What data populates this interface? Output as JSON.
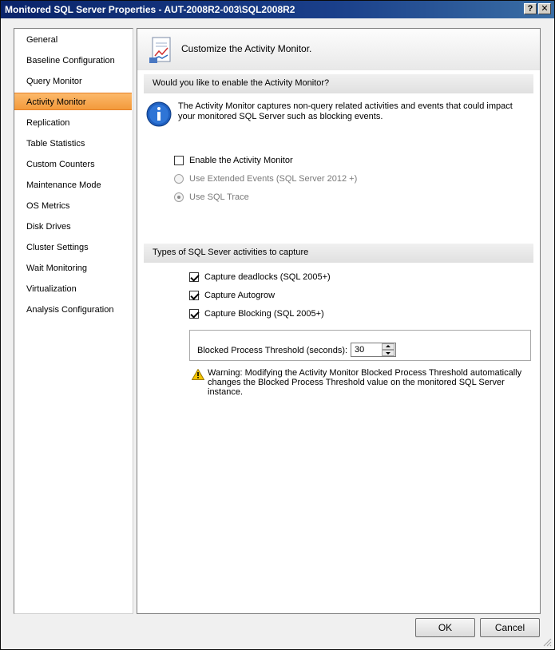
{
  "window": {
    "title": "Monitored SQL Server Properties - AUT-2008R2-003\\SQL2008R2",
    "help_label": "?",
    "close_label": "✕"
  },
  "sidebar": {
    "items": [
      {
        "label": "General",
        "selected": false
      },
      {
        "label": "Baseline Configuration",
        "selected": false
      },
      {
        "label": "Query Monitor",
        "selected": false
      },
      {
        "label": "Activity Monitor",
        "selected": true
      },
      {
        "label": "Replication",
        "selected": false
      },
      {
        "label": "Table Statistics",
        "selected": false
      },
      {
        "label": "Custom Counters",
        "selected": false
      },
      {
        "label": "Maintenance Mode",
        "selected": false
      },
      {
        "label": "OS Metrics",
        "selected": false
      },
      {
        "label": "Disk Drives",
        "selected": false
      },
      {
        "label": "Cluster Settings",
        "selected": false
      },
      {
        "label": "Wait Monitoring",
        "selected": false
      },
      {
        "label": "Virtualization",
        "selected": false
      },
      {
        "label": "Analysis Configuration",
        "selected": false
      }
    ]
  },
  "main": {
    "title": "Customize the Activity Monitor.",
    "enable_section": {
      "heading": "Would you like to enable the Activity Monitor?",
      "info_text": "The Activity Monitor captures non-query related activities and events that could impact your monitored SQL Server such as blocking events.",
      "enable_checkbox": {
        "label": "Enable the Activity Monitor",
        "checked": false
      },
      "extended_events_radio": {
        "label": "Use Extended Events (SQL Server 2012 +)",
        "selected": false,
        "enabled": false
      },
      "sql_trace_radio": {
        "label": "Use SQL Trace",
        "selected": true,
        "enabled": false
      }
    },
    "capture_section": {
      "heading": "Types of SQL Sever activities to capture",
      "deadlocks": {
        "label": "Capture deadlocks (SQL 2005+)",
        "checked": true
      },
      "autogrow": {
        "label": "Capture Autogrow",
        "checked": true
      },
      "blocking": {
        "label": "Capture Blocking (SQL 2005+)",
        "checked": true
      },
      "threshold_label": "Blocked Process Threshold (seconds):",
      "threshold_value": "30",
      "warning_text": "Warning: Modifying the Activity Monitor Blocked Process Threshold automatically changes the Blocked Process Threshold value on the monitored SQL Server instance."
    }
  },
  "footer": {
    "ok_label": "OK",
    "cancel_label": "Cancel"
  },
  "colors": {
    "title_bar": "#0a246a",
    "selected_nav": "#f39a3b",
    "info_icon": "#1f5fbf",
    "warning_icon": "#f5c400"
  }
}
